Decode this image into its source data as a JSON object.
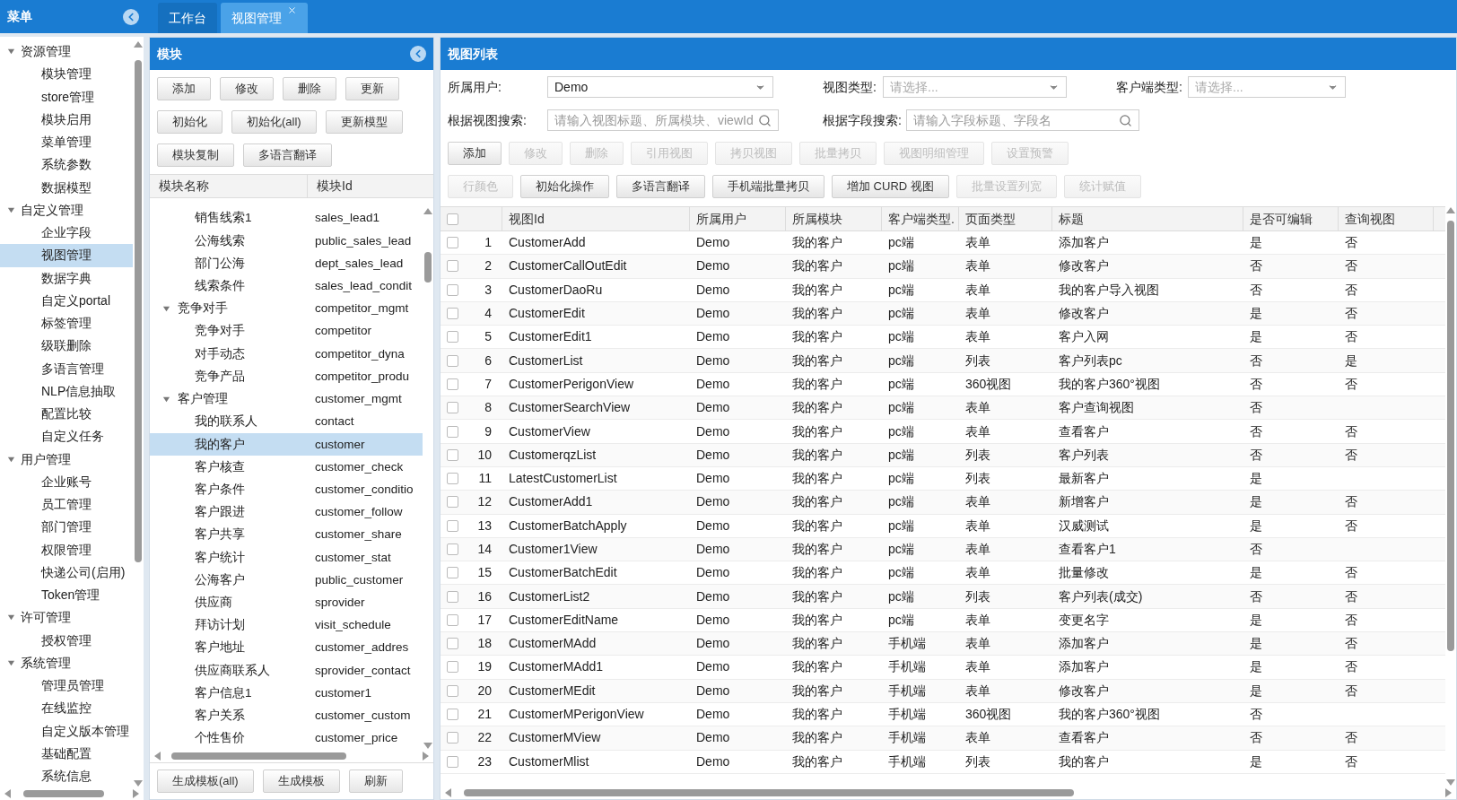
{
  "menu": {
    "title": "菜单",
    "groups": [
      {
        "label": "资源管理",
        "expanded": true,
        "children": [
          {
            "label": "模块管理",
            "selected": false
          },
          {
            "label": "store管理",
            "selected": false
          },
          {
            "label": "模块启用",
            "selected": false
          },
          {
            "label": "菜单管理",
            "selected": false
          },
          {
            "label": "系统参数",
            "selected": false
          },
          {
            "label": "数据模型",
            "selected": false
          }
        ]
      },
      {
        "label": "自定义管理",
        "expanded": true,
        "children": [
          {
            "label": "企业字段",
            "selected": false
          },
          {
            "label": "视图管理",
            "selected": true
          },
          {
            "label": "数据字典",
            "selected": false
          },
          {
            "label": "自定义portal",
            "selected": false
          },
          {
            "label": "标签管理",
            "selected": false
          },
          {
            "label": "级联删除",
            "selected": false
          },
          {
            "label": "多语言管理",
            "selected": false
          },
          {
            "label": "NLP信息抽取",
            "selected": false
          },
          {
            "label": "配置比较",
            "selected": false
          },
          {
            "label": "自定义任务",
            "selected": false
          }
        ]
      },
      {
        "label": "用户管理",
        "expanded": true,
        "children": [
          {
            "label": "企业账号",
            "selected": false
          },
          {
            "label": "员工管理",
            "selected": false
          },
          {
            "label": "部门管理",
            "selected": false
          },
          {
            "label": "权限管理",
            "selected": false
          },
          {
            "label": "快递公司(启用)",
            "selected": false
          },
          {
            "label": "Token管理",
            "selected": false
          }
        ]
      },
      {
        "label": "许可管理",
        "expanded": true,
        "children": [
          {
            "label": "授权管理",
            "selected": false
          }
        ]
      },
      {
        "label": "系统管理",
        "expanded": true,
        "children": [
          {
            "label": "管理员管理",
            "selected": false
          },
          {
            "label": "在线监控",
            "selected": false
          },
          {
            "label": "自定义版本管理",
            "selected": false
          },
          {
            "label": "基础配置",
            "selected": false
          },
          {
            "label": "系统信息",
            "selected": false
          }
        ]
      }
    ]
  },
  "tabs": [
    {
      "label": "工作台",
      "selected": false,
      "closable": false
    },
    {
      "label": "视图管理",
      "selected": true,
      "closable": true
    }
  ],
  "modules": {
    "title": "模块",
    "button_rows": [
      [
        "添加",
        "修改",
        "删除",
        "更新"
      ],
      [
        "初始化",
        "初始化(all)",
        "更新模型"
      ],
      [
        "模块复制",
        "多语言翻译"
      ]
    ],
    "columns": [
      "模块名称",
      "模块Id"
    ],
    "continued_rows": [
      {
        "name": "销售线索1",
        "id": "sales_lead1",
        "selected": false
      },
      {
        "name": "公海线索",
        "id": "public_sales_lead",
        "selected": false
      },
      {
        "name": "部门公海",
        "id": "dept_sales_lead",
        "selected": false
      },
      {
        "name": "线索条件",
        "id": "sales_lead_condit",
        "selected": false
      }
    ],
    "groups": [
      {
        "name": "竞争对手",
        "id": "competitor_mgmt",
        "expanded": true,
        "children": [
          {
            "name": "竞争对手",
            "id": "competitor",
            "selected": false
          },
          {
            "name": "对手动态",
            "id": "competitor_dyna",
            "selected": false
          },
          {
            "name": "竞争产品",
            "id": "competitor_produ",
            "selected": false
          }
        ]
      },
      {
        "name": "客户管理",
        "id": "customer_mgmt",
        "expanded": true,
        "children": [
          {
            "name": "我的联系人",
            "id": "contact",
            "selected": false
          },
          {
            "name": "我的客户",
            "id": "customer",
            "selected": true
          },
          {
            "name": "客户核查",
            "id": "customer_check",
            "selected": false
          },
          {
            "name": "客户条件",
            "id": "customer_conditio",
            "selected": false
          },
          {
            "name": "客户跟进",
            "id": "customer_follow",
            "selected": false
          },
          {
            "name": "客户共享",
            "id": "customer_share",
            "selected": false
          },
          {
            "name": "客户统计",
            "id": "customer_stat",
            "selected": false
          },
          {
            "name": "公海客户",
            "id": "public_customer",
            "selected": false
          },
          {
            "name": "供应商",
            "id": "sprovider",
            "selected": false
          },
          {
            "name": "拜访计划",
            "id": "visit_schedule",
            "selected": false
          },
          {
            "name": "客户地址",
            "id": "customer_addres",
            "selected": false
          },
          {
            "name": "供应商联系人",
            "id": "sprovider_contact",
            "selected": false
          },
          {
            "name": "客户信息1",
            "id": "customer1",
            "selected": false
          },
          {
            "name": "客户关系",
            "id": "customer_custom",
            "selected": false
          },
          {
            "name": "个性售价",
            "id": "customer_price",
            "selected": false
          }
        ]
      }
    ],
    "footer_buttons": [
      "生成模板(all)",
      "生成模板",
      "刷新"
    ]
  },
  "views": {
    "title": "视图列表",
    "filters": [
      {
        "label": "所属用户:",
        "kind": "select",
        "value": "Demo"
      },
      {
        "label": "视图类型:",
        "kind": "select",
        "placeholder": "请选择..."
      },
      {
        "label": "客户端类型:",
        "kind": "select",
        "placeholder": "请选择..."
      },
      {
        "label": "根据视图搜索:",
        "kind": "search",
        "placeholder": "请输入视图标题、所属模块、viewId"
      },
      {
        "label": "根据字段搜索:",
        "kind": "search",
        "placeholder": "请输入字段标题、字段名"
      }
    ],
    "button_rows": [
      [
        {
          "label": "添加",
          "disabled": false
        },
        {
          "label": "修改",
          "disabled": true
        },
        {
          "label": "删除",
          "disabled": true
        },
        {
          "label": "引用视图",
          "disabled": true
        },
        {
          "label": "拷贝视图",
          "disabled": true
        },
        {
          "label": "批量拷贝",
          "disabled": true
        },
        {
          "label": "视图明细管理",
          "disabled": true
        },
        {
          "label": "设置预警",
          "disabled": true
        }
      ],
      [
        {
          "label": "行颜色",
          "disabled": true
        },
        {
          "label": "初始化操作",
          "disabled": false
        },
        {
          "label": "多语言翻译",
          "disabled": false
        },
        {
          "label": "手机端批量拷贝",
          "disabled": false
        },
        {
          "label": "增加 CURD 视图",
          "disabled": false
        },
        {
          "label": "批量设置列宽",
          "disabled": true
        },
        {
          "label": "统计赋值",
          "disabled": true
        }
      ]
    ],
    "table": {
      "all_checked": false,
      "columns": [
        "视图Id",
        "所属用户",
        "所属模块",
        "客户端类型.",
        "页面类型",
        "标题",
        "是否可编辑",
        "查询视图"
      ],
      "rows": [
        {
          "checked": false,
          "no": "1",
          "cells": [
            "CustomerAdd",
            "Demo",
            "我的客户",
            "pc端",
            "表单",
            "添加客户",
            "是",
            "否"
          ]
        },
        {
          "checked": false,
          "no": "2",
          "cells": [
            "CustomerCallOutEdit",
            "Demo",
            "我的客户",
            "pc端",
            "表单",
            "修改客户",
            "否",
            "否"
          ]
        },
        {
          "checked": false,
          "no": "3",
          "cells": [
            "CustomerDaoRu",
            "Demo",
            "我的客户",
            "pc端",
            "表单",
            "我的客户导入视图",
            "否",
            "否"
          ]
        },
        {
          "checked": false,
          "no": "4",
          "cells": [
            "CustomerEdit",
            "Demo",
            "我的客户",
            "pc端",
            "表单",
            "修改客户",
            "是",
            "否"
          ]
        },
        {
          "checked": false,
          "no": "5",
          "cells": [
            "CustomerEdit1",
            "Demo",
            "我的客户",
            "pc端",
            "表单",
            "客户入网",
            "是",
            "否"
          ]
        },
        {
          "checked": false,
          "no": "6",
          "cells": [
            "CustomerList",
            "Demo",
            "我的客户",
            "pc端",
            "列表",
            "客户列表pc",
            "否",
            "是"
          ]
        },
        {
          "checked": false,
          "no": "7",
          "cells": [
            "CustomerPerigonView",
            "Demo",
            "我的客户",
            "pc端",
            "360视图",
            "我的客户360°视图",
            "否",
            "否"
          ]
        },
        {
          "checked": false,
          "no": "8",
          "cells": [
            "CustomerSearchView",
            "Demo",
            "我的客户",
            "pc端",
            "表单",
            "客户查询视图",
            "否"
          ]
        },
        {
          "checked": false,
          "no": "9",
          "cells": [
            "CustomerView",
            "Demo",
            "我的客户",
            "pc端",
            "表单",
            "查看客户",
            "否",
            "否"
          ]
        },
        {
          "checked": false,
          "no": "10",
          "cells": [
            "CustomerqzList",
            "Demo",
            "我的客户",
            "pc端",
            "列表",
            "客户列表",
            "否",
            "否"
          ]
        },
        {
          "checked": false,
          "no": "11",
          "cells": [
            "LatestCustomerList",
            "Demo",
            "我的客户",
            "pc端",
            "列表",
            "最新客户",
            "是"
          ]
        },
        {
          "checked": false,
          "no": "12",
          "cells": [
            "CustomerAdd1",
            "Demo",
            "我的客户",
            "pc端",
            "表单",
            "新增客户",
            "是",
            "否"
          ]
        },
        {
          "checked": false,
          "no": "13",
          "cells": [
            "CustomerBatchApply",
            "Demo",
            "我的客户",
            "pc端",
            "表单",
            "汉威测试",
            "是",
            "否"
          ]
        },
        {
          "checked": false,
          "no": "14",
          "cells": [
            "Customer1View",
            "Demo",
            "我的客户",
            "pc端",
            "表单",
            "查看客户1",
            "否"
          ]
        },
        {
          "checked": false,
          "no": "15",
          "cells": [
            "CustomerBatchEdit",
            "Demo",
            "我的客户",
            "pc端",
            "表单",
            "批量修改",
            "是",
            "否"
          ]
        },
        {
          "checked": false,
          "no": "16",
          "cells": [
            "CustomerList2",
            "Demo",
            "我的客户",
            "pc端",
            "列表",
            "客户列表(成交)",
            "否",
            "否"
          ]
        },
        {
          "checked": false,
          "no": "17",
          "cells": [
            "CustomerEditName",
            "Demo",
            "我的客户",
            "pc端",
            "表单",
            "变更名字",
            "是",
            "否"
          ]
        },
        {
          "checked": false,
          "no": "18",
          "cells": [
            "CustomerMAdd",
            "Demo",
            "我的客户",
            "手机端",
            "表单",
            "添加客户",
            "是",
            "否"
          ]
        },
        {
          "checked": false,
          "no": "19",
          "cells": [
            "CustomerMAdd1",
            "Demo",
            "我的客户",
            "手机端",
            "表单",
            "添加客户",
            "是",
            "否"
          ]
        },
        {
          "checked": false,
          "no": "20",
          "cells": [
            "CustomerMEdit",
            "Demo",
            "我的客户",
            "手机端",
            "表单",
            "修改客户",
            "是",
            "否"
          ]
        },
        {
          "checked": false,
          "no": "21",
          "cells": [
            "CustomerMPerigonView",
            "Demo",
            "我的客户",
            "手机端",
            "360视图",
            "我的客户360°视图",
            "否"
          ]
        },
        {
          "checked": false,
          "no": "22",
          "cells": [
            "CustomerMView",
            "Demo",
            "我的客户",
            "手机端",
            "表单",
            "查看客户",
            "否",
            "否"
          ]
        },
        {
          "checked": false,
          "no": "23",
          "cells": [
            "CustomerMlist",
            "Demo",
            "我的客户",
            "手机端",
            "列表",
            "我的客户",
            "是",
            "否"
          ]
        }
      ]
    }
  }
}
